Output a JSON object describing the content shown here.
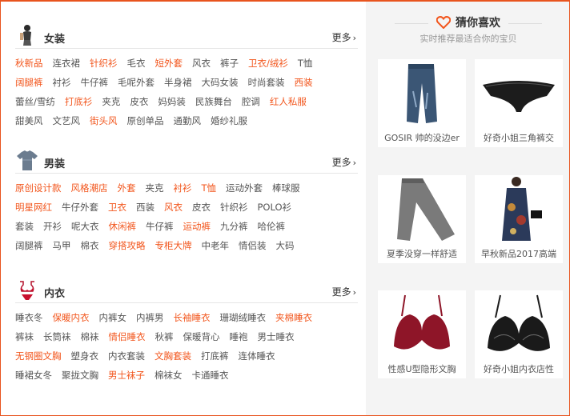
{
  "womens": {
    "title": "女装",
    "more": "更多",
    "rows": [
      [
        {
          "t": "秋新品",
          "hot": true
        },
        {
          "t": "连衣裙",
          "hot": false
        },
        {
          "t": "针织衫",
          "hot": true
        },
        {
          "t": "毛衣",
          "hot": false
        },
        {
          "t": "短外套",
          "hot": true
        },
        {
          "t": "风衣",
          "hot": false
        },
        {
          "t": "裤子",
          "hot": false
        },
        {
          "t": "卫衣/绒衫",
          "hot": true
        },
        {
          "t": "T恤",
          "hot": false
        }
      ],
      [
        {
          "t": "阔腿裤",
          "hot": true
        },
        {
          "t": "衬衫",
          "hot": false
        },
        {
          "t": "牛仔裤",
          "hot": false
        },
        {
          "t": "毛呢外套",
          "hot": false
        },
        {
          "t": "半身裙",
          "hot": false
        },
        {
          "t": "大码女装",
          "hot": false
        },
        {
          "t": "时尚套装",
          "hot": false
        },
        {
          "t": "西装",
          "hot": true
        }
      ],
      [
        {
          "t": "蕾丝/雪纺",
          "hot": false
        },
        {
          "t": "打底衫",
          "hot": true
        },
        {
          "t": "夹克",
          "hot": false
        },
        {
          "t": "皮衣",
          "hot": false
        },
        {
          "t": "妈妈装",
          "hot": false
        },
        {
          "t": "民族舞台",
          "hot": false
        },
        {
          "t": "腔调",
          "hot": false
        },
        {
          "t": "红人私服",
          "hot": true
        }
      ],
      [
        {
          "t": "甜美风",
          "hot": false
        },
        {
          "t": "文艺风",
          "hot": false
        },
        {
          "t": "街头风",
          "hot": true
        },
        {
          "t": "原创单品",
          "hot": false
        },
        {
          "t": "通勤风",
          "hot": false
        },
        {
          "t": "婚纱礼服",
          "hot": false
        }
      ]
    ]
  },
  "mens": {
    "title": "男装",
    "more": "更多",
    "rows": [
      [
        {
          "t": "原创设计款",
          "hot": true
        },
        {
          "t": "风格潮店",
          "hot": true
        },
        {
          "t": "外套",
          "hot": true
        },
        {
          "t": "夹克",
          "hot": false
        },
        {
          "t": "衬衫",
          "hot": true
        },
        {
          "t": "T恤",
          "hot": true
        },
        {
          "t": "运动外套",
          "hot": false
        },
        {
          "t": "棒球服",
          "hot": false
        }
      ],
      [
        {
          "t": "明星网红",
          "hot": true
        },
        {
          "t": "牛仔外套",
          "hot": false
        },
        {
          "t": "卫衣",
          "hot": true
        },
        {
          "t": "西装",
          "hot": false
        },
        {
          "t": "风衣",
          "hot": true
        },
        {
          "t": "皮衣",
          "hot": false
        },
        {
          "t": "针织衫",
          "hot": false
        },
        {
          "t": "POLO衫",
          "hot": false
        }
      ],
      [
        {
          "t": "套装",
          "hot": false
        },
        {
          "t": "开衫",
          "hot": false
        },
        {
          "t": "呢大衣",
          "hot": false
        },
        {
          "t": "休闲裤",
          "hot": true
        },
        {
          "t": "牛仔裤",
          "hot": false
        },
        {
          "t": "运动裤",
          "hot": true
        },
        {
          "t": "九分裤",
          "hot": false
        },
        {
          "t": "哈伦裤",
          "hot": false
        }
      ],
      [
        {
          "t": "阔腿裤",
          "hot": false
        },
        {
          "t": "马甲",
          "hot": false
        },
        {
          "t": "棉衣",
          "hot": false
        },
        {
          "t": "穿搭攻略",
          "hot": true
        },
        {
          "t": "专柜大牌",
          "hot": true
        },
        {
          "t": "中老年",
          "hot": false
        },
        {
          "t": "情侣装",
          "hot": false
        },
        {
          "t": "大码",
          "hot": false
        }
      ]
    ]
  },
  "underwear": {
    "title": "内衣",
    "more": "更多",
    "rows": [
      [
        {
          "t": "睡衣冬",
          "hot": false
        },
        {
          "t": "保暖内衣",
          "hot": true
        },
        {
          "t": "内裤女",
          "hot": false
        },
        {
          "t": "内裤男",
          "hot": false
        },
        {
          "t": "长袖睡衣",
          "hot": true
        },
        {
          "t": "珊瑚绒睡衣",
          "hot": false
        },
        {
          "t": "夹棉睡衣",
          "hot": true
        }
      ],
      [
        {
          "t": "裤袜",
          "hot": false
        },
        {
          "t": "长筒袜",
          "hot": false
        },
        {
          "t": "棉袜",
          "hot": false
        },
        {
          "t": "情侣睡衣",
          "hot": true
        },
        {
          "t": "秋裤",
          "hot": false
        },
        {
          "t": "保暖背心",
          "hot": false
        },
        {
          "t": "睡袍",
          "hot": false
        },
        {
          "t": "男士睡衣",
          "hot": false
        }
      ],
      [
        {
          "t": "无钢圈文胸",
          "hot": true
        },
        {
          "t": "塑身衣",
          "hot": false
        },
        {
          "t": "内衣套装",
          "hot": false
        },
        {
          "t": "文胸套装",
          "hot": true
        },
        {
          "t": "打底裤",
          "hot": false
        },
        {
          "t": "连体睡衣",
          "hot": false
        }
      ],
      [
        {
          "t": "睡裙女冬",
          "hot": false
        },
        {
          "t": "聚拢文胸",
          "hot": false
        },
        {
          "t": "男士袜子",
          "hot": true
        },
        {
          "t": "棉袜女",
          "hot": false
        },
        {
          "t": "卡通睡衣",
          "hot": false
        }
      ]
    ]
  },
  "recommend": {
    "title": "猜你喜欢",
    "subtitle": "实时推荐最适合你的宝贝",
    "items": [
      {
        "caption": "GOSIR 帅的没边er",
        "icon": "jeans-icon"
      },
      {
        "caption": "好奇小姐三角裤交",
        "icon": "lace-panties-icon"
      },
      {
        "caption": "夏季没穿一样舒适",
        "icon": "trousers-icon"
      },
      {
        "caption": "早秋新品2017高端",
        "icon": "floral-coat-icon"
      },
      {
        "caption": "性感U型隐形文胸",
        "icon": "red-bra-icon"
      },
      {
        "caption": "好奇小姐内衣店性",
        "icon": "black-lace-bra-icon"
      }
    ]
  },
  "colors": {
    "accent": "#f2561d",
    "border": "#e8541e",
    "sidebar_bg": "#f4f4f4"
  }
}
